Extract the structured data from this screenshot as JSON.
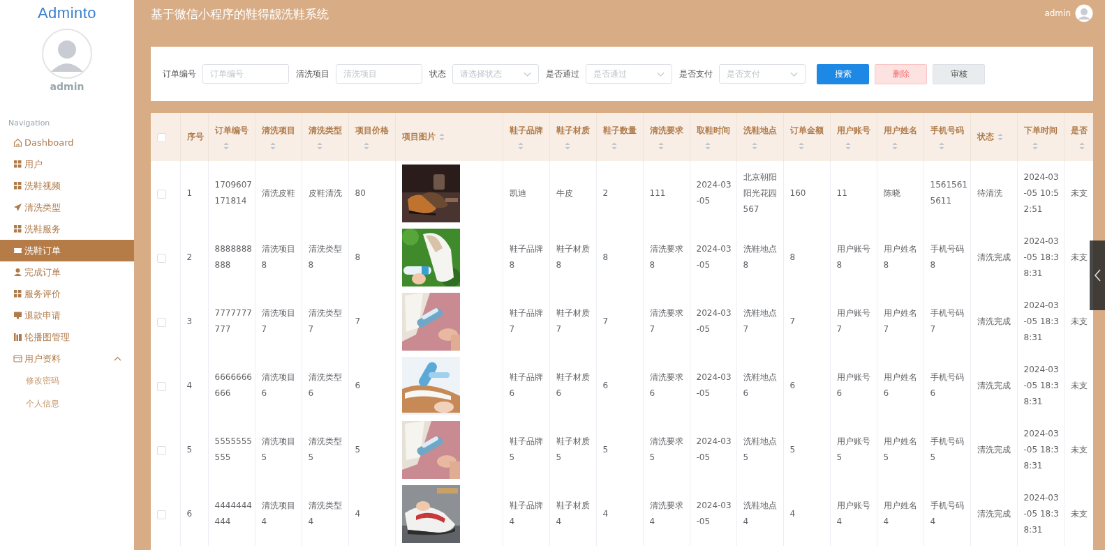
{
  "sidebar": {
    "logo": "Adminto",
    "user": "admin",
    "nav_heading": "Navigation",
    "items": [
      {
        "label": "Dashboard",
        "kind": "home",
        "selected": false
      },
      {
        "label": "用户",
        "kind": "grid",
        "selected": false
      },
      {
        "label": "洗鞋视频",
        "kind": "grid",
        "selected": false
      },
      {
        "label": "清洗类型",
        "kind": "send",
        "selected": false
      },
      {
        "label": "洗鞋服务",
        "kind": "grid",
        "selected": false
      },
      {
        "label": "洗鞋订单",
        "kind": "ticket",
        "selected": true
      },
      {
        "label": "完成订单",
        "kind": "user",
        "selected": false
      },
      {
        "label": "服务评价",
        "kind": "grid",
        "selected": false
      },
      {
        "label": "退款申请",
        "kind": "monitor",
        "selected": false
      },
      {
        "label": "轮播图管理",
        "kind": "chart",
        "selected": false
      },
      {
        "label": "用户资料",
        "kind": "card",
        "selected": false,
        "expanded": true,
        "children": [
          {
            "label": "修改密码",
            "selected": false
          },
          {
            "label": "个人信息",
            "selected": false
          }
        ]
      }
    ]
  },
  "header": {
    "title": "基于微信小程序的鞋得靓洗鞋系统",
    "user": "admin"
  },
  "filters": [
    {
      "kind": "input",
      "label": "订单编号",
      "placeholder": "订单编号"
    },
    {
      "kind": "input",
      "label": "清洗项目",
      "placeholder": "清洗项目"
    },
    {
      "kind": "select",
      "label": "状态",
      "placeholder": "请选择状态"
    },
    {
      "kind": "select",
      "label": "是否通过",
      "placeholder": "是否通过"
    },
    {
      "kind": "select",
      "label": "是否支付",
      "placeholder": "是否支付"
    }
  ],
  "buttons": [
    {
      "label": "搜索",
      "kind": "primary"
    },
    {
      "label": "删除",
      "kind": "danger"
    },
    {
      "label": "审核",
      "kind": "plain"
    }
  ],
  "table": {
    "select_all": {
      "checked": false
    },
    "columns": [
      {
        "label": "序号"
      },
      {
        "label": "订单编号",
        "sortable": true,
        "sort_below": true
      },
      {
        "label": "清洗项目",
        "sortable": true,
        "sort_below": true
      },
      {
        "label": "清洗类型",
        "sortable": true,
        "sort_below": true
      },
      {
        "label": "项目价格",
        "sortable": true,
        "sort_below": true
      },
      {
        "label": "项目图片",
        "sortable": true,
        "sort_below": false
      },
      {
        "label": "鞋子品牌",
        "sortable": true,
        "sort_below": true
      },
      {
        "label": "鞋子材质",
        "sortable": true,
        "sort_below": true
      },
      {
        "label": "鞋子数量",
        "sortable": true,
        "sort_below": true
      },
      {
        "label": "清洗要求",
        "sortable": true,
        "sort_below": true
      },
      {
        "label": "取鞋时间",
        "sortable": true,
        "sort_below": true
      },
      {
        "label": "洗鞋地点",
        "sortable": true,
        "sort_below": true
      },
      {
        "label": "订单金额",
        "sortable": true,
        "sort_below": true
      },
      {
        "label": "用户账号",
        "sortable": true,
        "sort_below": true
      },
      {
        "label": "用户姓名",
        "sortable": true,
        "sort_below": true
      },
      {
        "label": "手机号码",
        "sortable": true,
        "sort_below": true
      },
      {
        "label": "状态",
        "sortable": true,
        "sort_below": false
      },
      {
        "label": "下单时间",
        "sortable": true,
        "sort_below": true
      },
      {
        "label": "是否",
        "sortable": true,
        "sort_below": true
      }
    ],
    "rows": [
      {
        "checked": false,
        "cells": [
          "1",
          "1709607171814",
          "清洗皮鞋",
          "皮鞋清洗",
          "80",
          {
            "kind": "picture"
          },
          "凯迪",
          "牛皮",
          "2",
          "111",
          "2024-03-05",
          "北京朝阳阳光花园567",
          "160",
          "11",
          "陈晓",
          "15615615611",
          "待清洗",
          "2024-03-05 10:52:51",
          "未支"
        ]
      },
      {
        "checked": false,
        "cells": [
          "2",
          "8888888888",
          "清洗项目8",
          "清洗类型8",
          "8",
          {
            "kind": "picture"
          },
          "鞋子品牌8",
          "鞋子材质8",
          "8",
          "清洗要求8",
          "2024-03-05",
          "洗鞋地点8",
          "8",
          "用户账号8",
          "用户姓名8",
          "手机号码8",
          "清洗完成",
          "2024-03-05 18:38:31",
          "未支"
        ]
      },
      {
        "checked": false,
        "cells": [
          "3",
          "7777777777",
          "清洗项目7",
          "清洗类型7",
          "7",
          {
            "kind": "picture"
          },
          "鞋子品牌7",
          "鞋子材质7",
          "7",
          "清洗要求7",
          "2024-03-05",
          "洗鞋地点7",
          "7",
          "用户账号7",
          "用户姓名7",
          "手机号码7",
          "清洗完成",
          "2024-03-05 18:38:31",
          "未支"
        ]
      },
      {
        "checked": false,
        "cells": [
          "4",
          "6666666666",
          "清洗项目6",
          "清洗类型6",
          "6",
          {
            "kind": "picture"
          },
          "鞋子品牌6",
          "鞋子材质6",
          "6",
          "清洗要求6",
          "2024-03-05",
          "洗鞋地点6",
          "6",
          "用户账号6",
          "用户姓名6",
          "手机号码6",
          "清洗完成",
          "2024-03-05 18:38:31",
          "未支"
        ]
      },
      {
        "checked": false,
        "cells": [
          "5",
          "5555555555",
          "清洗项目5",
          "清洗类型5",
          "5",
          {
            "kind": "picture"
          },
          "鞋子品牌5",
          "鞋子材质5",
          "5",
          "清洗要求5",
          "2024-03-05",
          "洗鞋地点5",
          "5",
          "用户账号5",
          "用户姓名5",
          "手机号码5",
          "清洗完成",
          "2024-03-05 18:38:31",
          "未支"
        ]
      },
      {
        "checked": false,
        "cells": [
          "6",
          "4444444444",
          "清洗项目4",
          "清洗类型4",
          "4",
          {
            "kind": "picture"
          },
          "鞋子品牌4",
          "鞋子材质4",
          "4",
          "清洗要求4",
          "2024-03-05",
          "洗鞋地点4",
          "4",
          "用户账号4",
          "用户姓名4",
          "手机号码4",
          "清洗完成",
          "2024-03-05 18:38:31",
          "未支"
        ]
      }
    ]
  }
}
